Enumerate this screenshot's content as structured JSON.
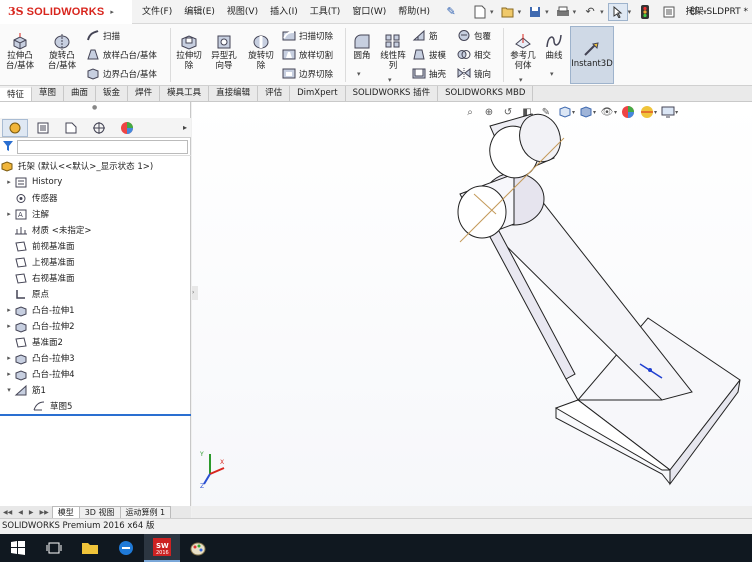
{
  "app": {
    "logo_prefix": "3S",
    "logo_text": "SOLIDWORKS",
    "document_title": "托架.SLDPRT *",
    "brand_color": "#d8251d"
  },
  "menu": [
    "文件(F)",
    "编辑(E)",
    "视图(V)",
    "插入(I)",
    "工具(T)",
    "窗口(W)",
    "帮助(H)"
  ],
  "ribbon": {
    "extrude_boss": "拉伸凸\n台/基体",
    "revolve_boss": "旋转凸\n台/基体",
    "sweep": "扫描",
    "loft_boss": "放样凸台/基体",
    "boundary_boss": "边界凸台/基体",
    "extrude_cut": "拉伸切\n除",
    "hole_wizard": "异型孔\n向导",
    "revolve_cut": "旋转切\n除",
    "swept_cut": "扫描切除",
    "lofted_cut": "放样切割",
    "boundary_cut": "边界切除",
    "fillet": "圆角",
    "linear_pattern": "线性阵\n列",
    "rib": "筋",
    "draft": "拔模",
    "shell": "抽壳",
    "wrap": "包覆",
    "intersect": "相交",
    "mirror": "镜向",
    "reference_geometry": "参考几\n何体",
    "curves": "曲线",
    "instant3d": "Instant3D"
  },
  "cm_tabs": [
    "特征",
    "草图",
    "曲面",
    "钣金",
    "焊件",
    "模具工具",
    "直接编辑",
    "评估",
    "DimXpert",
    "SOLIDWORKS 插件",
    "SOLIDWORKS MBD"
  ],
  "tree": {
    "root": "托架 (默认<<默认>_显示状态 1>)",
    "items": [
      {
        "label": "History",
        "expand": "▸"
      },
      {
        "label": "传感器",
        "expand": ""
      },
      {
        "label": "注解",
        "expand": "▸"
      },
      {
        "label": "材质 <未指定>",
        "expand": ""
      },
      {
        "label": "前视基准面",
        "expand": ""
      },
      {
        "label": "上视基准面",
        "expand": ""
      },
      {
        "label": "右视基准面",
        "expand": ""
      },
      {
        "label": "原点",
        "expand": ""
      },
      {
        "label": "凸台-拉伸1",
        "expand": "▸"
      },
      {
        "label": "凸台-拉伸2",
        "expand": "▸"
      },
      {
        "label": "基准面2",
        "expand": ""
      },
      {
        "label": "凸台-拉伸3",
        "expand": "▸"
      },
      {
        "label": "凸台-拉伸4",
        "expand": "▸"
      },
      {
        "label": "筋1",
        "expand": "▾"
      },
      {
        "label": "草图5",
        "expand": ""
      }
    ]
  },
  "bottom_tabs": [
    "模型",
    "3D 视图",
    "运动算例 1"
  ],
  "status": "SOLIDWORKS Premium 2016 x64 版",
  "taskbar": {
    "sw_badge": "2016"
  }
}
